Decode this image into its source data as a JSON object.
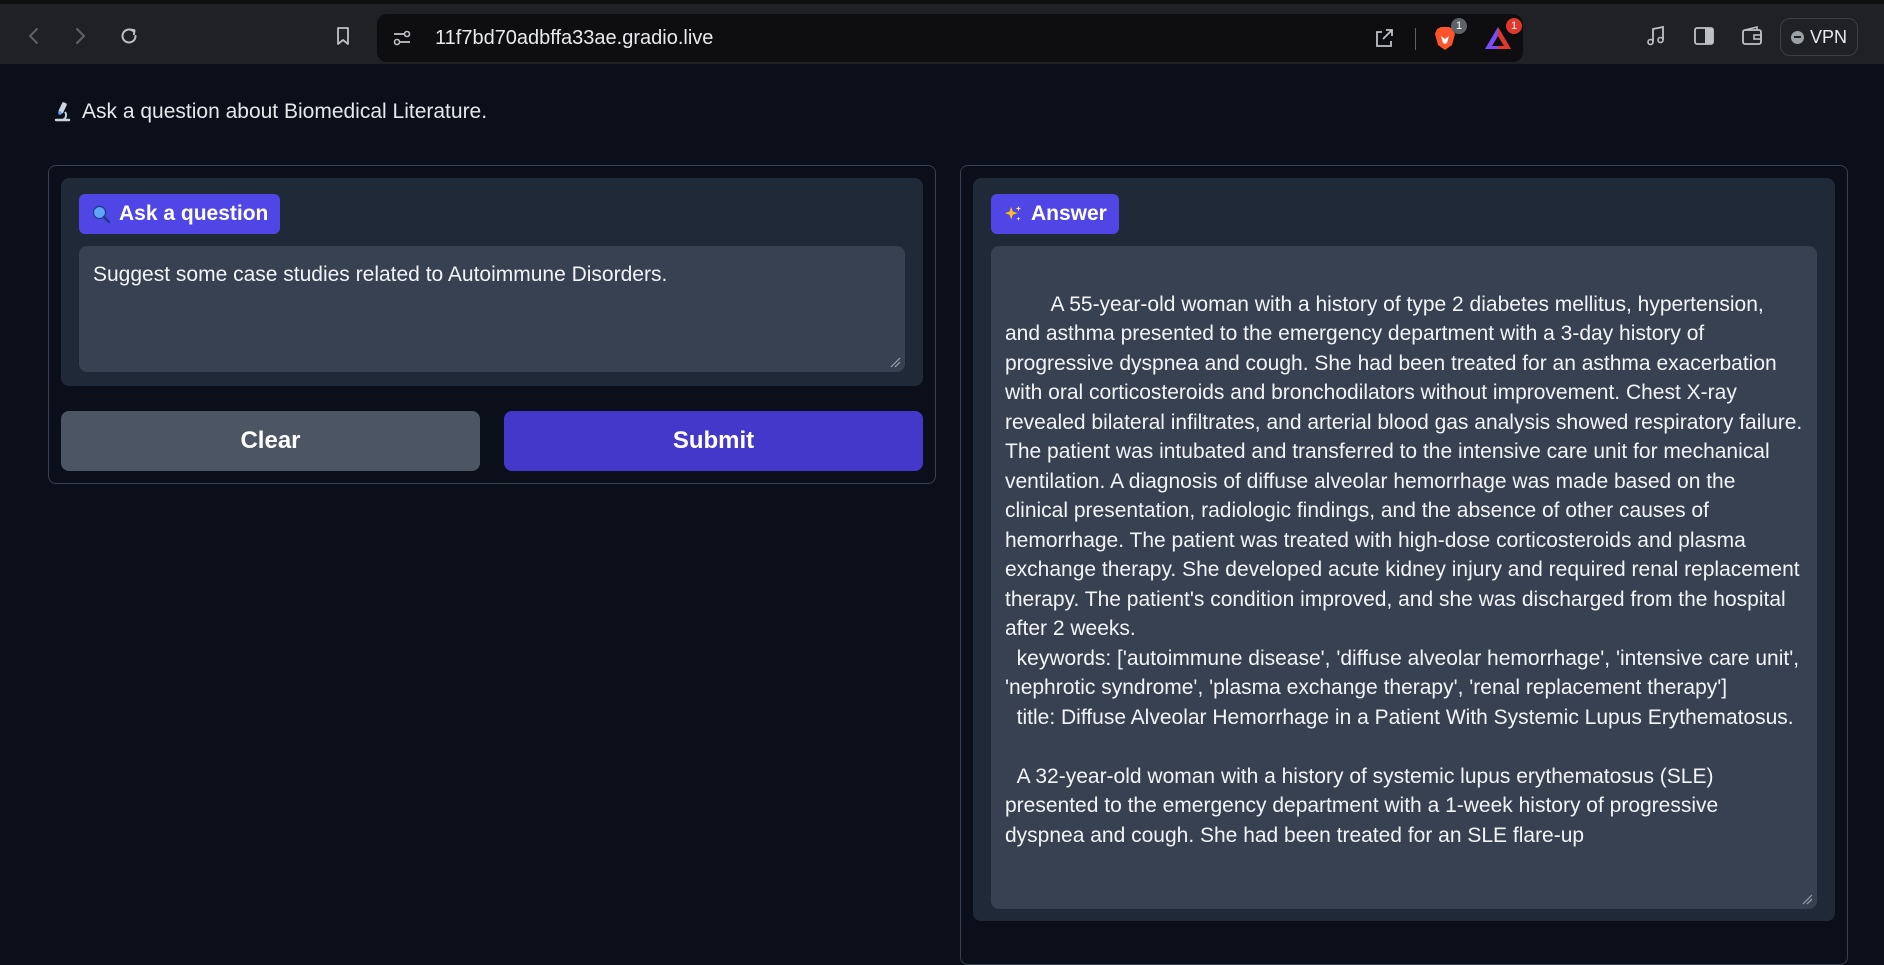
{
  "browser": {
    "url": "11f7bd70adbffa33ae.gradio.live",
    "brave_badge": "1",
    "rewards_badge": "1",
    "vpn_label": "VPN"
  },
  "app": {
    "header": "Ask a question about Biomedical Literature.",
    "question": {
      "label": "Ask a question",
      "value": "Suggest some case studies related to Autoimmune Disorders."
    },
    "buttons": {
      "clear": "Clear",
      "submit": "Submit"
    },
    "answer": {
      "label": "Answer",
      "value": "  A 55-year-old woman with a history of type 2 diabetes mellitus, hypertension, and asthma presented to the emergency department with a 3-day history of progressive dyspnea and cough. She had been treated for an asthma exacerbation with oral corticosteroids and bronchodilators without improvement. Chest X-ray revealed bilateral infiltrates, and arterial blood gas analysis showed respiratory failure. The patient was intubated and transferred to the intensive care unit for mechanical ventilation. A diagnosis of diffuse alveolar hemorrhage was made based on the clinical presentation, radiologic findings, and the absence of other causes of hemorrhage. The patient was treated with high-dose corticosteroids and plasma exchange therapy. She developed acute kidney injury and required renal replacement therapy. The patient's condition improved, and she was discharged from the hospital after 2 weeks.\n  keywords: ['autoimmune disease', 'diffuse alveolar hemorrhage', 'intensive care unit', 'nephrotic syndrome', 'plasma exchange therapy', 'renal replacement therapy']\n  title: Diffuse Alveolar Hemorrhage in a Patient With Systemic Lupus Erythematosus.\n\n  A 32-year-old woman with a history of systemic lupus erythematosus (SLE) presented to the emergency department with a 1-week history of progressive dyspnea and cough. She had been treated for an SLE flare-up"
    }
  },
  "colors": {
    "background": "#0b0f19",
    "block": "#1f2937",
    "input": "#374151",
    "accent": "#4f46e5",
    "submit": "#4338ca",
    "clear": "#4b5563"
  },
  "icons": {
    "back": "chevron-left-icon",
    "forward": "chevron-right-icon",
    "reload": "reload-icon",
    "bookmark": "bookmark-icon",
    "site_settings": "site-settings-icon",
    "share": "share-icon",
    "brave_shields": "brave-lion-icon",
    "rewards": "brave-rewards-icon",
    "music": "music-note-icon",
    "sidebar": "sidebar-icon",
    "wallet": "wallet-icon",
    "microscope": "microscope-icon",
    "magnifier": "magnifier-icon",
    "sparkles": "sparkles-icon"
  }
}
